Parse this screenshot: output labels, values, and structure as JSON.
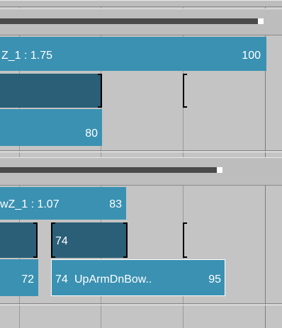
{
  "colors": {
    "clip_light": "#3a91b2",
    "clip_dark": "#2a5f77",
    "track": "#4a4a4a",
    "background": "#c4c4c4"
  },
  "track1": {
    "scroll_progress": 0.97,
    "clip_main": {
      "label": "Z_1 : 1.75",
      "end_value": "100"
    },
    "clip_sub": {
      "end_value": "80"
    }
  },
  "track2": {
    "scroll_progress": 0.94,
    "clip_main": {
      "label": "wZ_1 : 1.07",
      "end_value": "83"
    },
    "clip_sub_a": {
      "end_value": "72"
    },
    "clip_dark_b": {
      "start_value": "74"
    },
    "clip_selected": {
      "start_value": "74",
      "label": "UpArmDnBow..",
      "end_value": "95"
    }
  }
}
